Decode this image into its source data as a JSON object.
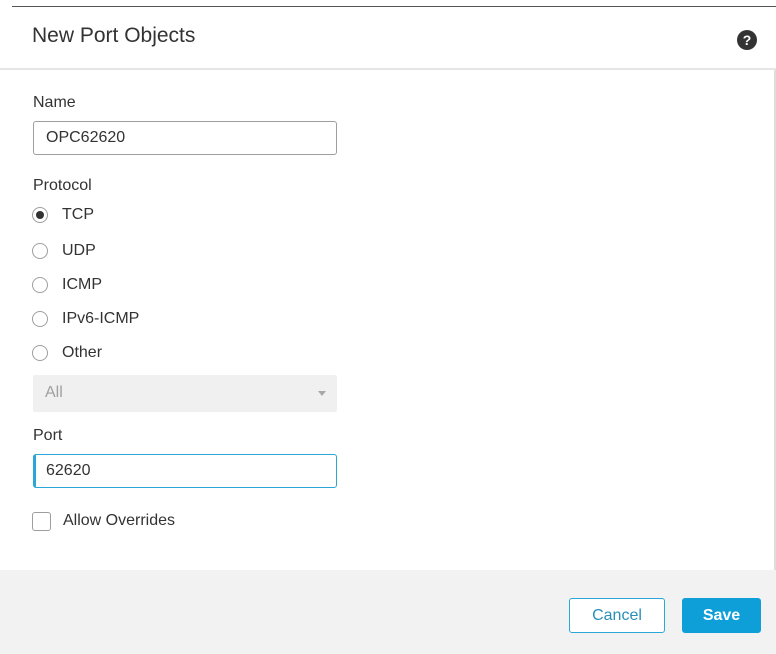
{
  "dialog": {
    "title": "New Port Objects",
    "help_icon": "question-mark-icon"
  },
  "name": {
    "label": "Name",
    "value": "OPC62620"
  },
  "protocol": {
    "label": "Protocol",
    "selected": "TCP",
    "options": [
      {
        "label": "TCP",
        "checked": true
      },
      {
        "label": "UDP",
        "checked": false
      },
      {
        "label": "ICMP",
        "checked": false
      },
      {
        "label": "IPv6-ICMP",
        "checked": false
      },
      {
        "label": "Other",
        "checked": false
      }
    ],
    "other_select_value": "All"
  },
  "port": {
    "label": "Port",
    "value": "62620"
  },
  "allow_overrides": {
    "label": "Allow Overrides",
    "checked": false
  },
  "footer": {
    "cancel_label": "Cancel",
    "save_label": "Save"
  },
  "colors": {
    "accent": "#0e9fd8",
    "footer_bg": "#f2f2f2",
    "text": "#333333"
  }
}
